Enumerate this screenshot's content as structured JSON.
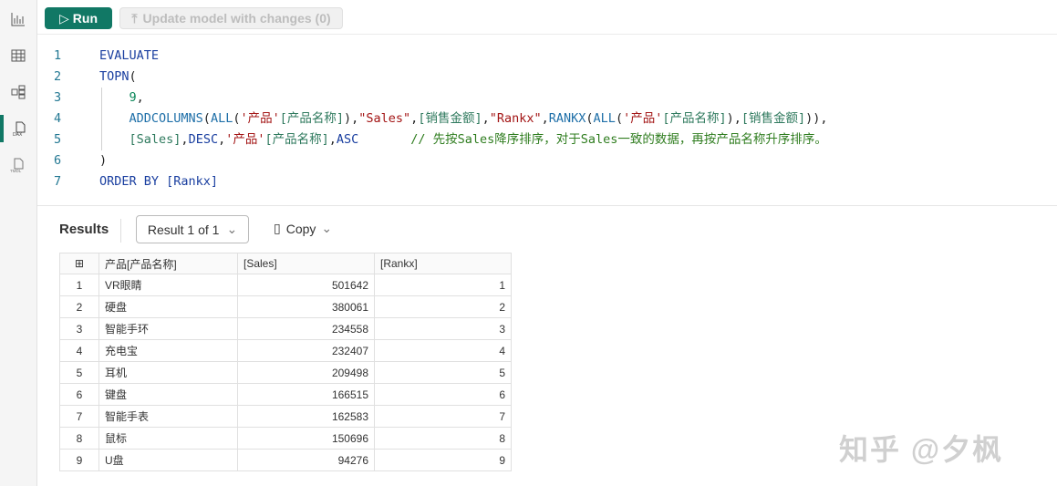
{
  "sidebar": {
    "items": [
      {
        "name": "report-view",
        "icon": "bar-chart-icon"
      },
      {
        "name": "table-view",
        "icon": "table-icon"
      },
      {
        "name": "model-view",
        "icon": "model-icon"
      },
      {
        "name": "dax-query-view",
        "icon": "dax-file-icon",
        "label": "DAX",
        "active": true
      },
      {
        "name": "tmdl-view",
        "icon": "tmdl-file-icon",
        "label": "TMDL"
      }
    ]
  },
  "toolbar": {
    "run_label": "Run",
    "update_label": "Update model with changes (0)"
  },
  "editor": {
    "lines": [
      {
        "n": "1",
        "tokens": [
          [
            "kw",
            "EVALUATE"
          ]
        ]
      },
      {
        "n": "2",
        "tokens": [
          [
            "kw",
            "TOPN"
          ],
          [
            "pn",
            "("
          ]
        ]
      },
      {
        "n": "3",
        "tokens": [
          [
            "pn",
            "    "
          ],
          [
            "num",
            "9"
          ],
          [
            "pn",
            ","
          ]
        ]
      },
      {
        "n": "4",
        "tokens": [
          [
            "pn",
            "    "
          ],
          [
            "fn",
            "ADDCOLUMNS"
          ],
          [
            "pn",
            "("
          ],
          [
            "fn",
            "ALL"
          ],
          [
            "pn",
            "("
          ],
          [
            "tb",
            "'产品'"
          ],
          [
            "col",
            "[产品名称]"
          ],
          [
            "pn",
            "),"
          ],
          [
            "str",
            "\"Sales\""
          ],
          [
            "pn",
            ","
          ],
          [
            "col",
            "[销售金额]"
          ],
          [
            "pn",
            ","
          ],
          [
            "str",
            "\"Rankx\""
          ],
          [
            "pn",
            ","
          ],
          [
            "fn",
            "RANKX"
          ],
          [
            "pn",
            "("
          ],
          [
            "fn",
            "ALL"
          ],
          [
            "pn",
            "("
          ],
          [
            "tb",
            "'产品'"
          ],
          [
            "col",
            "[产品名称]"
          ],
          [
            "pn",
            "),"
          ],
          [
            "col",
            "[销售金额]"
          ],
          [
            "pn",
            "))"
          ],
          [
            "pn",
            ","
          ]
        ]
      },
      {
        "n": "5",
        "tokens": [
          [
            "pn",
            "    "
          ],
          [
            "col",
            "[Sales]"
          ],
          [
            "pn",
            ","
          ],
          [
            "kw",
            "DESC"
          ],
          [
            "pn",
            ","
          ],
          [
            "tb",
            "'产品'"
          ],
          [
            "col",
            "[产品名称]"
          ],
          [
            "pn",
            ","
          ],
          [
            "kw",
            "ASC"
          ],
          [
            "pn",
            "       "
          ],
          [
            "cm",
            "// 先按Sales降序排序，对于Sales一致的数据，再按产品名称升序排序。"
          ]
        ]
      },
      {
        "n": "6",
        "tokens": [
          [
            "pn",
            ")"
          ]
        ]
      },
      {
        "n": "7",
        "tokens": [
          [
            "kw",
            "ORDER BY "
          ],
          [
            "ref",
            "[Rankx]"
          ]
        ]
      }
    ]
  },
  "results": {
    "label": "Results",
    "selector": "Result 1 of 1",
    "copy_label": "Copy",
    "columns": [
      "产品[产品名称]",
      "[Sales]",
      "[Rankx]"
    ],
    "rows": [
      [
        "1",
        "VR眼睛",
        "501642",
        "1"
      ],
      [
        "2",
        "硬盘",
        "380061",
        "2"
      ],
      [
        "3",
        "智能手环",
        "234558",
        "3"
      ],
      [
        "4",
        "充电宝",
        "232407",
        "4"
      ],
      [
        "5",
        "耳机",
        "209498",
        "5"
      ],
      [
        "6",
        "键盘",
        "166515",
        "6"
      ],
      [
        "7",
        "智能手表",
        "162583",
        "7"
      ],
      [
        "8",
        "鼠标",
        "150696",
        "8"
      ],
      [
        "9",
        "U盘",
        "94276",
        "9"
      ]
    ]
  },
  "watermark": "知乎 @夕枫"
}
